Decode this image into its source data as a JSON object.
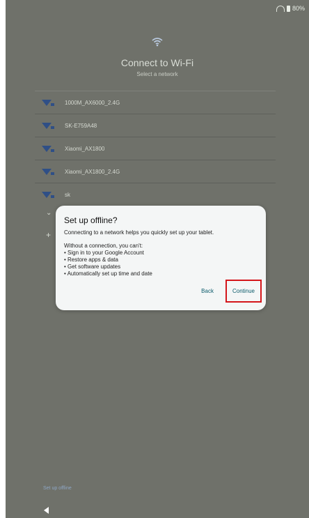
{
  "status_bar": {
    "battery_text": "80%"
  },
  "header": {
    "title": "Connect to Wi-Fi",
    "subtitle": "Select a network"
  },
  "networks": [
    {
      "name": "1000M_AX6000_2.4G"
    },
    {
      "name": "SK-E759A48"
    },
    {
      "name": "Xiaomi_AX1800"
    },
    {
      "name": "Xiaomi_AX1800_2.4G"
    },
    {
      "name": "sk"
    }
  ],
  "dialog": {
    "title": "Set up offline?",
    "intro": "Connecting to a network helps you quickly set up your tablet.",
    "without_label": "Without a connection, you can't:",
    "bullets": [
      "• Sign in to your Google Account",
      "• Restore apps & data",
      "• Get software updates",
      "• Automatically set up time and date"
    ],
    "back_label": "Back",
    "continue_label": "Continue"
  },
  "footer": {
    "setup_offline_link": "Set up offline"
  },
  "colors": {
    "scrim_background": "#6f716a",
    "dialog_background": "#f4f6f6",
    "accent_text": "#0b5b6b",
    "highlight_border": "#d4151a"
  },
  "icons": {
    "header": "wifi-icon",
    "network": "wifi-signal-icon",
    "nav": "back-triangle-icon"
  }
}
